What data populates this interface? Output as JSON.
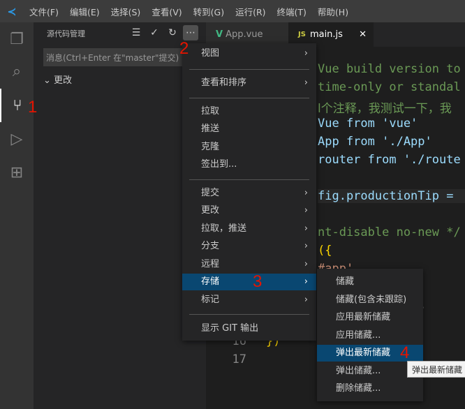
{
  "titlebar": {
    "logo": "vscode-logo",
    "menu": [
      "文件(F)",
      "编辑(E)",
      "选择(S)",
      "查看(V)",
      "转到(G)",
      "运行(R)",
      "终端(T)",
      "帮助(H)"
    ]
  },
  "activity": [
    "files-icon",
    "search-icon",
    "source-control-icon",
    "run-debug-icon",
    "extensions-icon"
  ],
  "sidebar": {
    "title": "源代码管理",
    "message_placeholder": "消息(Ctrl+Enter 在\"master\"提交)",
    "changes": "更改"
  },
  "tabs": [
    {
      "label": "App.vue",
      "icon": "V",
      "active": false
    },
    {
      "label": "main.js",
      "icon": "JS",
      "active": true,
      "close": "✕"
    }
  ],
  "code": {
    "lines": [
      {
        "text": "Vue build version to"
      },
      {
        "text": "time-only or standal"
      },
      {
        "text": "l个注释，我测试一下，我"
      },
      {
        "text": "Vue from 'vue'"
      },
      {
        "text": "App from './App'"
      },
      {
        "text": "router from './route"
      },
      {
        "text": "fig.productionTip = "
      },
      {
        "text": "nt-disable no-new */"
      },
      {
        "text": "({"
      },
      {
        "text": "#app',"
      },
      {
        "text": ","
      },
      {
        "text": "})"
      }
    ],
    "line_numbers": [
      "16",
      "17"
    ]
  },
  "menu": {
    "items": [
      "视图",
      "查看和排序",
      "拉取",
      "推送",
      "克隆",
      "签出到...",
      "提交",
      "更改",
      "拉取，推送",
      "分支",
      "远程",
      "存储",
      "标记",
      "显示 GIT 输出"
    ]
  },
  "submenu": {
    "items": [
      "储藏",
      "储藏(包含未跟踪)",
      "应用最新储藏",
      "应用储藏...",
      "弹出最新储藏",
      "弹出储藏...",
      "删除储藏..."
    ]
  },
  "tooltip": "弹出最新储藏",
  "annotations": [
    "1",
    "2",
    "3",
    "4"
  ],
  "colors": {
    "highlight": "#094771",
    "annotation": "#e51400"
  }
}
